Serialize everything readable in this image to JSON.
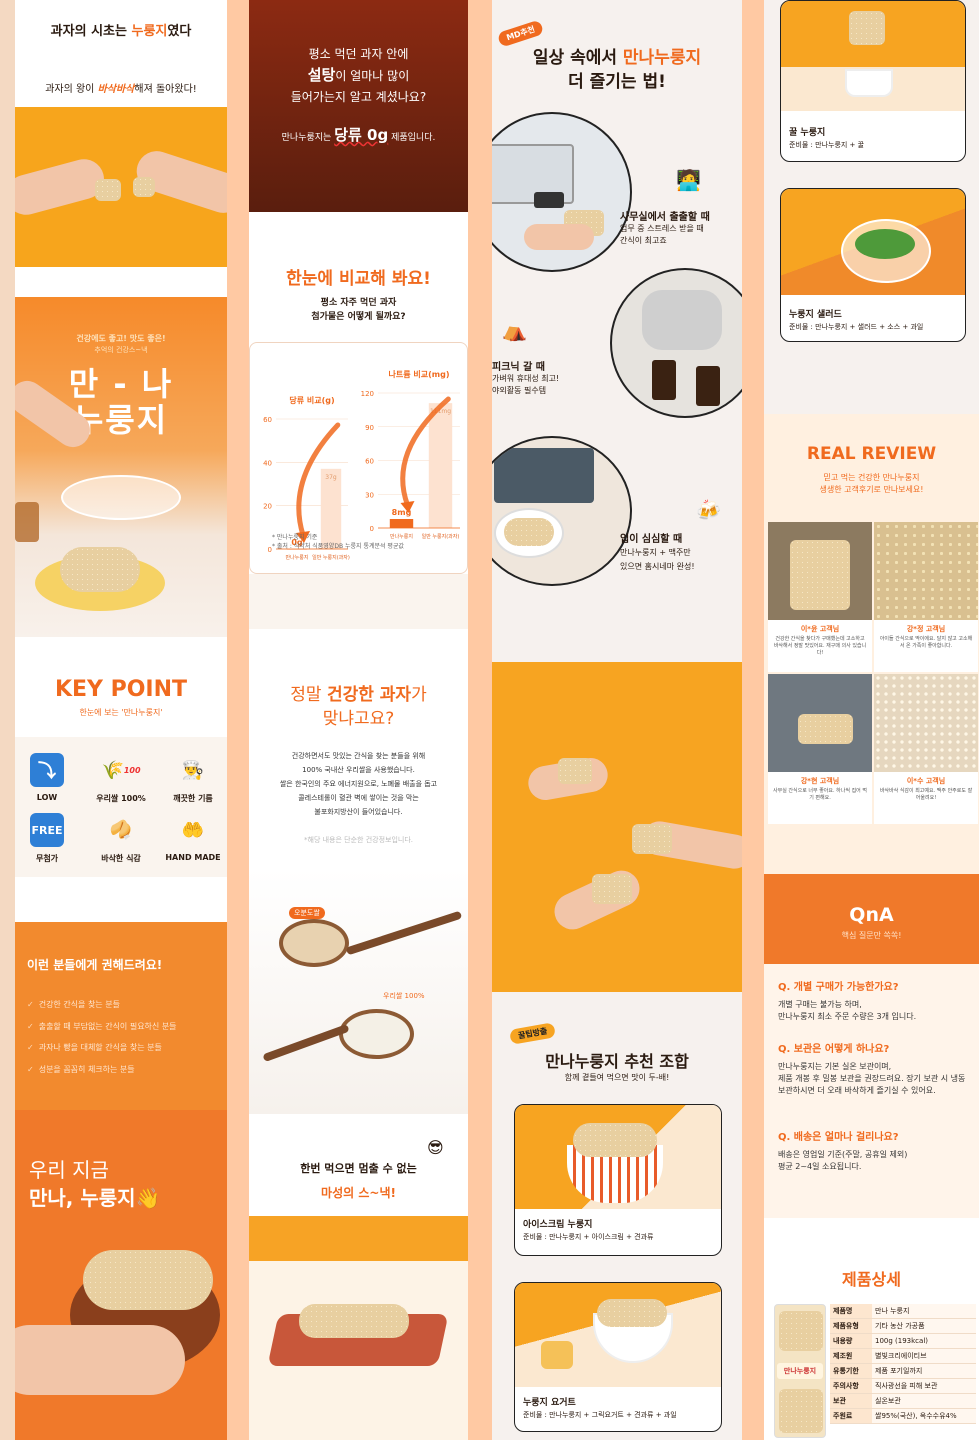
{
  "col1": {
    "intro_title_prefix": "과자의 시초는",
    "intro_title_em": "누룽지",
    "intro_title_suffix": "였다",
    "intro_sub_prefix": "과자의 왕이",
    "intro_sub_em": "바삭바삭",
    "intro_sub_suffix": "해져 돌아왔다!",
    "hero_tagline_1": "건강에도 좋고! 맛도 좋은!",
    "hero_tagline_2": "추억의 건강스~낵",
    "hero_brand_1": "만 - 나",
    "hero_brand_2": "누룽지",
    "kp_title": "KEY POINT",
    "kp_sub": "한눈에 보는 '만나누룽지'",
    "kp_items": [
      {
        "icon": "arrow-down-icon",
        "glyph": "⤵",
        "label": "LOW"
      },
      {
        "icon": "rice-plant-icon",
        "glyph": "🌾",
        "label": "우리쌀 100%"
      },
      {
        "icon": "chef-icon",
        "glyph": "👨‍🍳",
        "label": "깨끗한 기름"
      },
      {
        "icon": "free-badge-icon",
        "glyph": "FREE",
        "label": "무첨가"
      },
      {
        "icon": "fortune-cookie-icon",
        "glyph": "🥠",
        "label": "바삭한 식감"
      },
      {
        "icon": "hands-icon",
        "glyph": "🤲",
        "label": "HAND MADE"
      }
    ],
    "kp_badge": "100",
    "recommend_title": "이런 분들에게 권해드려요!",
    "recommend_items": [
      "건강한 간식을 찾는 분들",
      "출출할 때 부담없는 간식이 필요하신 분들",
      "과자나 빵을 대체할 간식을 찾는 분들",
      "성분을 꼼꼼히 체크하는 분들"
    ],
    "closing_1": "우리 지금",
    "closing_2": "만나, 누룽지👋"
  },
  "col2": {
    "sugar_q1": "평소 먹던 과자 안에",
    "sugar_q2_em": "설탕",
    "sugar_q2": "이 얼마나 많이",
    "sugar_q3": "들어가는지 알고 계셨나요?",
    "sugar_a_prefix": "만나누룽지는",
    "sugar_a_em": "당류 0g",
    "sugar_a_suffix": "제품입니다.",
    "compare_title": "한눈에 비교해 봐요!",
    "compare_sub_1": "평소 자주 먹던 과자",
    "compare_sub_2": "첨가물은 어떻게 될까요?",
    "note_1": "* 만나누룽지 기준",
    "note_2": "* 출처 : 식약처 식품영양DB 누룽지 통계분석 평균값",
    "healthy_1_prefix": "정말",
    "healthy_1_em": "건강한 과자",
    "healthy_1_suffix": "가",
    "healthy_2": "맞냐고요?",
    "healthy_body": [
      "건강하면서도 맛있는 간식을 찾는 분들을 위해",
      "100% 국내산 우리쌀을 사용했습니다.",
      "쌀은 한국인의 주요 에너지원으로, 노폐물 배출을 돕고",
      "콜레스테롤이 혈관 벽에 쌓이는 것을 막는",
      "불포화지방산이 들어있습니다."
    ],
    "healthy_note": "*해당 내용은 단순한 건강정보입니다.",
    "spoon_label_1": "오분도쌀",
    "spoon_label_2": "우리쌀 100%",
    "addictive_1": "한번 먹으면 멈출 수 없는",
    "addictive_2": "마성의 스~낵!"
  },
  "chart_data": [
    {
      "type": "bar",
      "title": "당류 비교(g)",
      "categories": [
        "만나누룽지",
        "일반 누룽지(과자)"
      ],
      "values": [
        0,
        37
      ],
      "data_labels": [
        "0g",
        "37g"
      ],
      "ylim": [
        0,
        60
      ],
      "yticks": [
        0,
        20,
        40,
        60
      ]
    },
    {
      "type": "bar",
      "title": "나트륨 비교(mg)",
      "categories": [
        "만나누룽지",
        "일반 누룽지(과자)"
      ],
      "values": [
        8,
        111
      ],
      "data_labels": [
        "8mg",
        "111mg"
      ],
      "ylim": [
        0,
        120
      ],
      "yticks": [
        0,
        30,
        60,
        90,
        120
      ]
    }
  ],
  "col3": {
    "md_badge": "MD추천",
    "md_title_1_prefix": "일상 속에서",
    "md_title_1_em": "만나누룽지",
    "md_title_2": "더 즐기는 법!",
    "scene_office_title": "사무실에서 출출할 때",
    "scene_office_desc_1": "업무 중 스트레스 받을 때",
    "scene_office_desc_2": "간식이 최고죠",
    "scene_picnic_title": "피크닉 갈 때",
    "scene_picnic_desc_1": "가벼워 휴대성 최고!",
    "scene_picnic_desc_2": "야외활동 필수템",
    "scene_snack_title": "입이 심심할 때",
    "scene_snack_desc_1": "만나누룽지 + 맥주만",
    "scene_snack_desc_2": "있으면 홈시네마 완성!",
    "honey_badge": "꿀팁방출",
    "combo_title": "만나누룽지 추천 조합",
    "combo_sub": "함께 곁들여 먹으면 맛이 두-배!",
    "combo_1_name": "아이스크림 누룽지",
    "combo_1_desc": "준비물 : 만나누룽지 + 아이스크림 + 견과류",
    "combo_2_name": "누룽지 요거트",
    "combo_2_desc": "준비물 : 만나누룽지 + 그릭요거트 + 견과류 + 과일"
  },
  "col4": {
    "combo_3_name": "꿀 누룽지",
    "combo_3_desc": "준비물 : 만나누룽지 + 꿀",
    "combo_4_name": "누룽지 샐러드",
    "combo_4_desc": "준비물 : 만나누룽지 + 샐러드 + 소스 + 과일",
    "review_title": "REAL REVIEW",
    "review_sub_1": "믿고 먹는 건강한 만나누룽지",
    "review_sub_2": "생생한 고객후기로 만나보세요!",
    "reviews": [
      {
        "name": "이*윤 고객님",
        "text": "건강한 간식을 찾다가 구매했는데 고소하고 바삭해서 정말 맛있어요. 재구매 의사 있습니다!"
      },
      {
        "name": "강*정 고객님",
        "text": "아이들 간식으로 딱이에요. 달지 않고 고소해서 온 가족이 좋아합니다."
      },
      {
        "name": "강*현 고객님",
        "text": "사무실 간식으로 너무 좋아요. 하나씩 집어 먹기 편해요."
      },
      {
        "name": "이*수 고객님",
        "text": "바삭바삭 식감이 최고예요. 맥주 안주로도 잘 어울려요!"
      }
    ],
    "qna_title": "QnA",
    "qna_sub": "핵심 질문만 쏙쏙!",
    "qna": [
      {
        "q": "Q. 개별 구매가 가능한가요?",
        "a1": "개별 구매는 불가능 하며,",
        "a2": "만나누룽지 최소 주문 수량은 3개 입니다."
      },
      {
        "q": "Q. 보관은 어떻게 하나요?",
        "a1": "만나누룽지는 기본 실온 보관이며,",
        "a2": "제품 개봉 후 밀봉 보관을 권장드려요. 장기 보관 시 냉동 보관하시면 더 오래 바삭하게 즐기실 수 있어요."
      },
      {
        "q": "Q. 배송은 얼마나 걸리나요?",
        "a1": "배송은 영업일 기준(주말, 공휴일 제외)",
        "a2": "평균 2~4일 소요됩니다."
      }
    ],
    "detail_title": "제품상세",
    "detail_rows": [
      [
        "제품명",
        "만나 누룽지"
      ],
      [
        "제품유형",
        "기타 농산 가공품"
      ],
      [
        "내용량",
        "100g (193kcal)"
      ],
      [
        "제조원",
        "별빛크리에이티브"
      ],
      [
        "유통기한",
        "제품 포기일까지"
      ],
      [
        "주의사항",
        "직사광선을 피해 보관"
      ],
      [
        "보관",
        "실온보관"
      ],
      [
        "주원료",
        "쌀95%(국산), 옥수수유4%"
      ]
    ],
    "package_label": "만나누룽지"
  }
}
